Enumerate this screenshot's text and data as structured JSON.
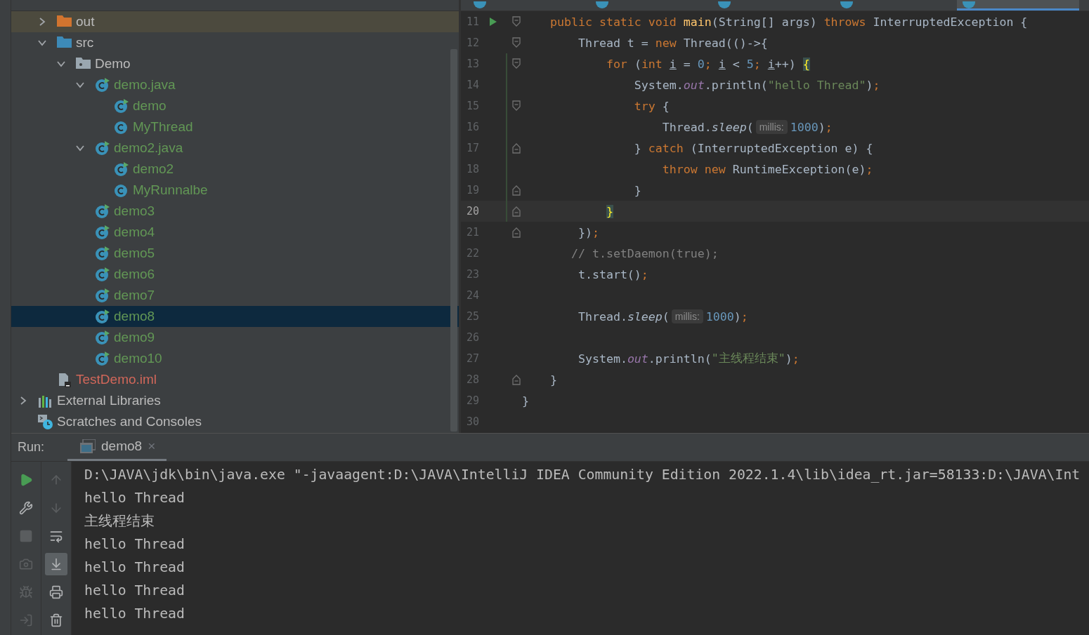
{
  "editor_tabs": [
    {
      "selected": false
    },
    {
      "selected": false
    },
    {
      "selected": false
    },
    {
      "selected": false
    },
    {
      "selected": true
    }
  ],
  "tree": {
    "project_items": [
      {
        "label": "out",
        "kind": "excluded-folder",
        "expanded": false,
        "selected": false
      },
      {
        "label": "src",
        "kind": "source-folder",
        "expanded": true,
        "selected": false,
        "children": [
          {
            "label": "Demo",
            "kind": "package",
            "expanded": true,
            "selected": false,
            "children": [
              {
                "label": "demo.java",
                "kind": "runnable-class",
                "color": "#629755",
                "expanded": true,
                "selected": false,
                "children": [
                  {
                    "label": "demo",
                    "kind": "runnable-class",
                    "color": "#629755",
                    "selected": false
                  },
                  {
                    "label": "MyThread",
                    "kind": "class",
                    "color": "#629755",
                    "selected": false
                  }
                ]
              },
              {
                "label": "demo2.java",
                "kind": "runnable-class",
                "color": "#629755",
                "expanded": true,
                "selected": false,
                "children": [
                  {
                    "label": "demo2",
                    "kind": "runnable-class",
                    "color": "#629755",
                    "selected": false
                  },
                  {
                    "label": "MyRunnalbe",
                    "kind": "class",
                    "color": "#629755",
                    "selected": false
                  }
                ]
              },
              {
                "label": "demo3",
                "kind": "runnable-class",
                "color": "#629755",
                "selected": false
              },
              {
                "label": "demo4",
                "kind": "runnable-class",
                "color": "#629755",
                "selected": false
              },
              {
                "label": "demo5",
                "kind": "runnable-class",
                "color": "#629755",
                "selected": false
              },
              {
                "label": "demo6",
                "kind": "runnable-class",
                "color": "#629755",
                "selected": false
              },
              {
                "label": "demo7",
                "kind": "runnable-class",
                "color": "#629755",
                "selected": false
              },
              {
                "label": "demo8",
                "kind": "runnable-class",
                "color": "#629755",
                "selected": true
              },
              {
                "label": "demo9",
                "kind": "runnable-class",
                "color": "#629755",
                "selected": false
              },
              {
                "label": "demo10",
                "kind": "runnable-class",
                "color": "#629755",
                "selected": false
              }
            ]
          }
        ]
      },
      {
        "label": "TestDemo.iml",
        "kind": "module-file",
        "color": "#d1675a",
        "selected": false
      }
    ],
    "root_items": [
      {
        "label": "External Libraries",
        "kind": "libraries",
        "expanded": false,
        "selected": false
      },
      {
        "label": "Scratches and Consoles",
        "kind": "scratches",
        "selected": false
      }
    ]
  },
  "code_lines": [
    {
      "number": "11",
      "run_marker": true,
      "fold_open": true,
      "tokens": [
        {
          "kind": "keyword",
          "text": "    public static void "
        },
        {
          "kind": "function",
          "text": "main"
        },
        {
          "kind": "plain",
          "text": "(String[] args) "
        },
        {
          "kind": "keyword",
          "text": "throws "
        },
        {
          "kind": "plain",
          "text": "InterruptedException {"
        }
      ]
    },
    {
      "number": "12",
      "fold_open": true,
      "tokens": [
        {
          "kind": "plain",
          "text": "        Thread t = "
        },
        {
          "kind": "keyword",
          "text": "new "
        },
        {
          "kind": "plain",
          "text": "Thread(()->{"
        }
      ]
    },
    {
      "number": "13",
      "changed": true,
      "fold_open": true,
      "tokens": [
        {
          "kind": "keyword",
          "text": "            for"
        },
        {
          "kind": "plain",
          "text": " ("
        },
        {
          "kind": "keyword",
          "text": "int "
        },
        {
          "kind": "variable",
          "text": "i"
        },
        {
          "kind": "plain",
          "text": " = "
        },
        {
          "kind": "number",
          "text": "0"
        },
        {
          "kind": "punctuation",
          "text": "; "
        },
        {
          "kind": "variable",
          "text": "i"
        },
        {
          "kind": "plain",
          "text": " < "
        },
        {
          "kind": "number",
          "text": "5"
        },
        {
          "kind": "punctuation",
          "text": "; "
        },
        {
          "kind": "variable",
          "text": "i"
        },
        {
          "kind": "plain",
          "text": "++) "
        },
        {
          "kind": "brace",
          "text": "{"
        }
      ]
    },
    {
      "number": "14",
      "changed": true,
      "tokens": [
        {
          "kind": "plain",
          "text": "                System."
        },
        {
          "kind": "field",
          "text": "out"
        },
        {
          "kind": "plain",
          "text": ".println("
        },
        {
          "kind": "string",
          "text": "\"hello Thread\""
        },
        {
          "kind": "plain",
          "text": ")"
        },
        {
          "kind": "punctuation",
          "text": ";"
        }
      ]
    },
    {
      "number": "15",
      "changed": true,
      "fold_open": true,
      "tokens": [
        {
          "kind": "keyword",
          "text": "                try"
        },
        {
          "kind": "plain",
          "text": " {"
        }
      ]
    },
    {
      "number": "16",
      "changed": true,
      "tokens": [
        {
          "kind": "plain",
          "text": "                    Thread."
        },
        {
          "kind": "method",
          "text": "sleep"
        },
        {
          "kind": "plain",
          "text": "("
        },
        {
          "kind": "hint",
          "text": "millis:"
        },
        {
          "kind": "number",
          "text": "1000"
        },
        {
          "kind": "plain",
          "text": ")"
        },
        {
          "kind": "punctuation",
          "text": ";"
        }
      ]
    },
    {
      "number": "17",
      "changed": true,
      "fold_close": true,
      "tokens": [
        {
          "kind": "plain",
          "text": "                } "
        },
        {
          "kind": "keyword",
          "text": "catch"
        },
        {
          "kind": "plain",
          "text": " (InterruptedException e) {"
        }
      ]
    },
    {
      "number": "18",
      "changed": true,
      "tokens": [
        {
          "kind": "keyword",
          "text": "                    throw new"
        },
        {
          "kind": "plain",
          "text": " RuntimeException(e)"
        },
        {
          "kind": "punctuation",
          "text": ";"
        }
      ]
    },
    {
      "number": "19",
      "changed": true,
      "fold_close": true,
      "tokens": [
        {
          "kind": "plain",
          "text": "                }"
        }
      ]
    },
    {
      "number": "20",
      "changed": true,
      "current": true,
      "fold_close": true,
      "tokens": [
        {
          "kind": "brace",
          "text": "            }"
        }
      ]
    },
    {
      "number": "21",
      "fold_close": true,
      "tokens": [
        {
          "kind": "plain",
          "text": "        })"
        },
        {
          "kind": "punctuation",
          "text": ";"
        }
      ]
    },
    {
      "number": "22",
      "tokens": [
        {
          "kind": "comment",
          "text": "       // t.setDaemon(true);"
        }
      ]
    },
    {
      "number": "23",
      "tokens": [
        {
          "kind": "plain",
          "text": "        t.start()"
        },
        {
          "kind": "punctuation",
          "text": ";"
        }
      ]
    },
    {
      "number": "24"
    },
    {
      "number": "25",
      "tokens": [
        {
          "kind": "plain",
          "text": "        Thread."
        },
        {
          "kind": "method",
          "text": "sleep"
        },
        {
          "kind": "plain",
          "text": "("
        },
        {
          "kind": "hint",
          "text": "millis:"
        },
        {
          "kind": "number",
          "text": "1000"
        },
        {
          "kind": "plain",
          "text": ")"
        },
        {
          "kind": "punctuation",
          "text": ";"
        }
      ]
    },
    {
      "number": "26"
    },
    {
      "number": "27",
      "tokens": [
        {
          "kind": "plain",
          "text": "        System."
        },
        {
          "kind": "field",
          "text": "out"
        },
        {
          "kind": "plain",
          "text": ".println("
        },
        {
          "kind": "string",
          "text": "\"主线程结束\""
        },
        {
          "kind": "plain",
          "text": ")"
        },
        {
          "kind": "punctuation",
          "text": ";"
        }
      ]
    },
    {
      "number": "28",
      "fold_close": true,
      "tokens": [
        {
          "kind": "plain",
          "text": "    }"
        }
      ]
    },
    {
      "number": "29",
      "tokens": [
        {
          "kind": "plain",
          "text": "}"
        }
      ]
    },
    {
      "number": "30"
    }
  ],
  "run_panel": {
    "label": "Run:",
    "tab": {
      "label": "demo8",
      "close": "×",
      "selected": true
    },
    "toolbar_left": [
      {
        "disabled": false
      },
      {
        "disabled": false
      },
      {
        "disabled": true
      },
      {
        "disabled": true
      },
      {
        "disabled": true
      },
      {
        "disabled": true
      }
    ],
    "toolbar_right": [
      {
        "disabled": true,
        "selected": false
      },
      {
        "disabled": true,
        "selected": false
      },
      {
        "disabled": false,
        "selected": false
      },
      {
        "disabled": false,
        "selected": true
      },
      {
        "disabled": false,
        "selected": false
      },
      {
        "disabled": false,
        "selected": false
      }
    ],
    "console": [
      "D:\\JAVA\\jdk\\bin\\java.exe \"-javaagent:D:\\JAVA\\IntelliJ IDEA Community Edition 2022.1.4\\lib\\idea_rt.jar=58133:D:\\JAVA\\Int",
      "hello Thread",
      "主线程结束",
      "hello Thread",
      "hello Thread",
      "hello Thread",
      "hello Thread"
    ]
  }
}
